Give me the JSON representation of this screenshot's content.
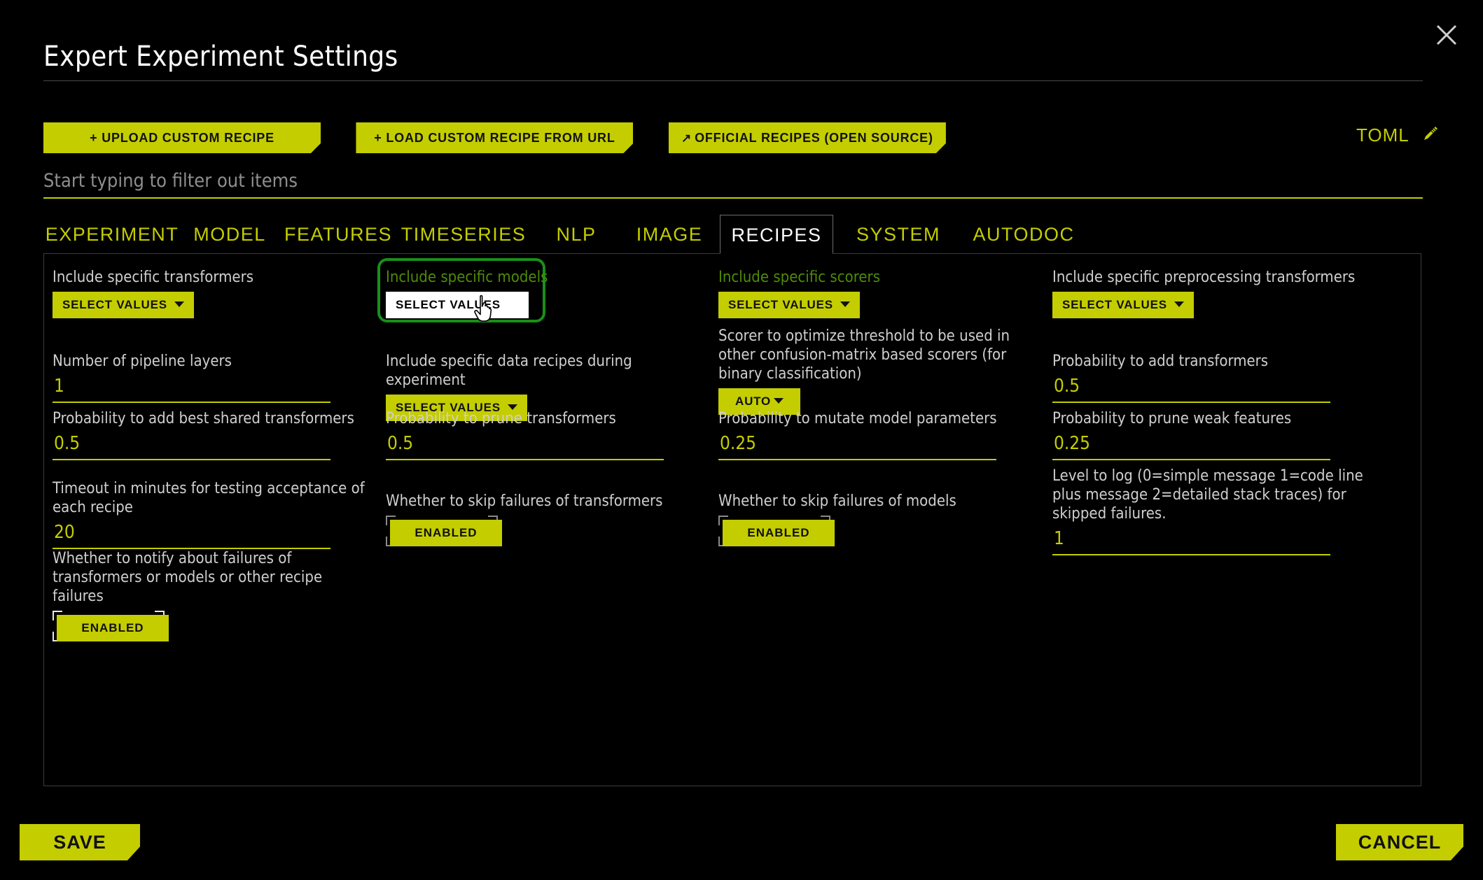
{
  "header": {
    "title": "Expert Experiment Settings",
    "close_icon": "close-icon"
  },
  "toolbar": {
    "upload_label": "+ UPLOAD CUSTOM RECIPE",
    "url_label": "+ LOAD CUSTOM RECIPE FROM URL",
    "official_label": "OFFICIAL RECIPES (OPEN SOURCE)",
    "official_icon": "external-link-arrow-icon",
    "toml_label": "TOML",
    "toml_icon": "pencil-icon"
  },
  "search": {
    "value": "",
    "placeholder": "Start typing to filter out items"
  },
  "tabs": [
    {
      "label": "EXPERIMENT",
      "active": false
    },
    {
      "label": "MODEL",
      "active": false
    },
    {
      "label": "FEATURES",
      "active": false
    },
    {
      "label": "TIMESERIES",
      "active": false
    },
    {
      "label": "NLP",
      "active": false
    },
    {
      "label": "IMAGE",
      "active": false
    },
    {
      "label": "RECIPES",
      "active": true
    },
    {
      "label": "SYSTEM",
      "active": false
    },
    {
      "label": "AUTODOC",
      "active": false
    }
  ],
  "colors": {
    "accent": "#c4cd00",
    "background": "#000000",
    "label": "#cfcfcf",
    "highlight_border": "#1a8f1a",
    "highlight_label": "#4e8b06"
  },
  "fields": {
    "include_transformers": {
      "label": "Include specific transformers",
      "button": "SELECT VALUES"
    },
    "include_models": {
      "label": "Include specific models",
      "button": "SELECT VALUES",
      "highlighted": true,
      "cursor": "pointing-hand-cursor"
    },
    "include_scorers": {
      "label": "Include specific scorers",
      "button": "SELECT VALUES"
    },
    "include_preprocessing": {
      "label": "Include specific preprocessing transformers",
      "button": "SELECT VALUES"
    },
    "pipeline_layers": {
      "label": "Number of pipeline layers",
      "value": "1"
    },
    "include_data_recipes": {
      "label": "Include specific data recipes during experiment",
      "button": "SELECT VALUES"
    },
    "threshold_scorer": {
      "label": "Scorer to optimize threshold to be used in other confusion-matrix based scorers (for binary classification)",
      "button": "AUTO"
    },
    "prob_add_transformers": {
      "label": "Probability to add transformers",
      "value": "0.5"
    },
    "prob_add_best_shared": {
      "label": "Probability to add best shared transformers",
      "value": "0.5"
    },
    "prob_prune_transformers": {
      "label": "Probability to prune transformers",
      "value": "0.5"
    },
    "prob_mutate_model_params": {
      "label": "Probability to mutate model parameters",
      "value": "0.25"
    },
    "prob_prune_weak_features": {
      "label": "Probability to prune weak features",
      "value": "0.25"
    },
    "timeout_minutes": {
      "label": "Timeout in minutes for testing acceptance of each recipe",
      "value": "20"
    },
    "skip_failures_transformers": {
      "label": "Whether to skip failures of transformers",
      "toggle": "ENABLED"
    },
    "skip_failures_models": {
      "label": "Whether to skip failures of models",
      "toggle": "ENABLED"
    },
    "level_to_log": {
      "label": "Level to log (0=simple message 1=code line plus message 2=detailed stack traces) for skipped failures.",
      "value": "1"
    },
    "notify_failures": {
      "label": "Whether to notify about failures of transformers or models or other recipe failures",
      "toggle": "ENABLED"
    }
  },
  "footer": {
    "save_label": "SAVE",
    "cancel_label": "CANCEL"
  }
}
